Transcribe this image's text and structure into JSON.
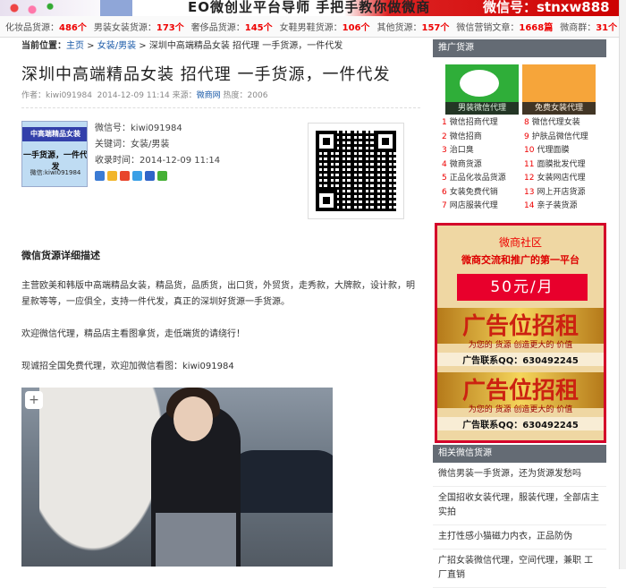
{
  "banner": {
    "slogan": "EO微创业平台导师 手把手教你做微商",
    "wechat": "微信号：stnxw888"
  },
  "categories": [
    {
      "label": "化妆品货源：",
      "count": "486个"
    },
    {
      "label": "男装女装货源：",
      "count": "173个"
    },
    {
      "label": "奢侈品货源：",
      "count": "145个"
    },
    {
      "label": "女鞋男鞋货源：",
      "count": "106个"
    },
    {
      "label": "其他货源：",
      "count": "157个"
    },
    {
      "label": "微信营销文章：",
      "count": "1668篇"
    },
    {
      "label": "微商群：",
      "count": "31个"
    }
  ],
  "breadcrumb": {
    "label": "当前位置：",
    "home": "主页",
    "sep1": " > ",
    "cat": "女装/男装",
    "sep2": " > ",
    "current": "深圳中高端精品女装 招代理 一手货源，一件代发"
  },
  "article": {
    "title": "深圳中高端精品女装 招代理 一手货源，一件代发",
    "meta_author": "作者：kiwi091984",
    "meta_date": "2014-12-09 11:14 来源：",
    "meta_source": "微商网",
    "meta_hits": " 热度：2006",
    "thumb_line1": "中高端精品女装",
    "thumb_line2": "一手货源，一件代发",
    "thumb_line3": "微信:kiwi091984",
    "wechat": "微信号：kiwi091984",
    "keywords": "关键词：女装/男装",
    "collected": "收录时间：2014-12-09 11:14",
    "section": "微信货源详细描述",
    "p1": "主营欧美和韩版中高端精品女装，精品货，品质货，出口货，外贸货，走秀款，大牌款，设计款，明星款等等，一应俱全，支持一件代发，真正的深圳好货源一手货源。",
    "p2": "欢迎微信代理，精品店主看图拿货，走低端货的请绕行！",
    "p3": "现诚招全国免费代理，欢迎加微信看图：kiwi091984"
  },
  "sidebar": {
    "promo_title": "推广货源",
    "promo_left": "男装微信代理",
    "promo_right": "免费女装代理",
    "links": [
      {
        "n": "1",
        "t": "微信招商代理"
      },
      {
        "n": "8",
        "t": "微信代理女装"
      },
      {
        "n": "2",
        "t": "微信招商"
      },
      {
        "n": "9",
        "t": "护肤品微信代理"
      },
      {
        "n": "3",
        "t": "治口臭"
      },
      {
        "n": "10",
        "t": "代理面膜"
      },
      {
        "n": "4",
        "t": "微商货源"
      },
      {
        "n": "11",
        "t": "面膜批发代理"
      },
      {
        "n": "5",
        "t": "正品化妆品货源"
      },
      {
        "n": "12",
        "t": "女装网店代理"
      },
      {
        "n": "6",
        "t": "女装免费代销"
      },
      {
        "n": "13",
        "t": "网上开店货源"
      },
      {
        "n": "7",
        "t": "网店服装代理"
      },
      {
        "n": "14",
        "t": "亲子装货源"
      }
    ],
    "ad": {
      "title": "微商社区",
      "subtitle": "微商交流和推广的第一平台",
      "price": "50元/月",
      "big": "广告位招租",
      "tag": "为您的 货源 创造更大的 价值",
      "qq": "广告联系QQ：630492245"
    },
    "related_title": "相关微信货源",
    "related": [
      "微信男装一手货源，还为货源发愁吗",
      "全国招收女装代理，服装代理，全部店主实拍",
      "主打性感小猫磁力内衣，正品防伪",
      "广招女装微信代理，空间代理，兼职 工厂直销"
    ]
  }
}
